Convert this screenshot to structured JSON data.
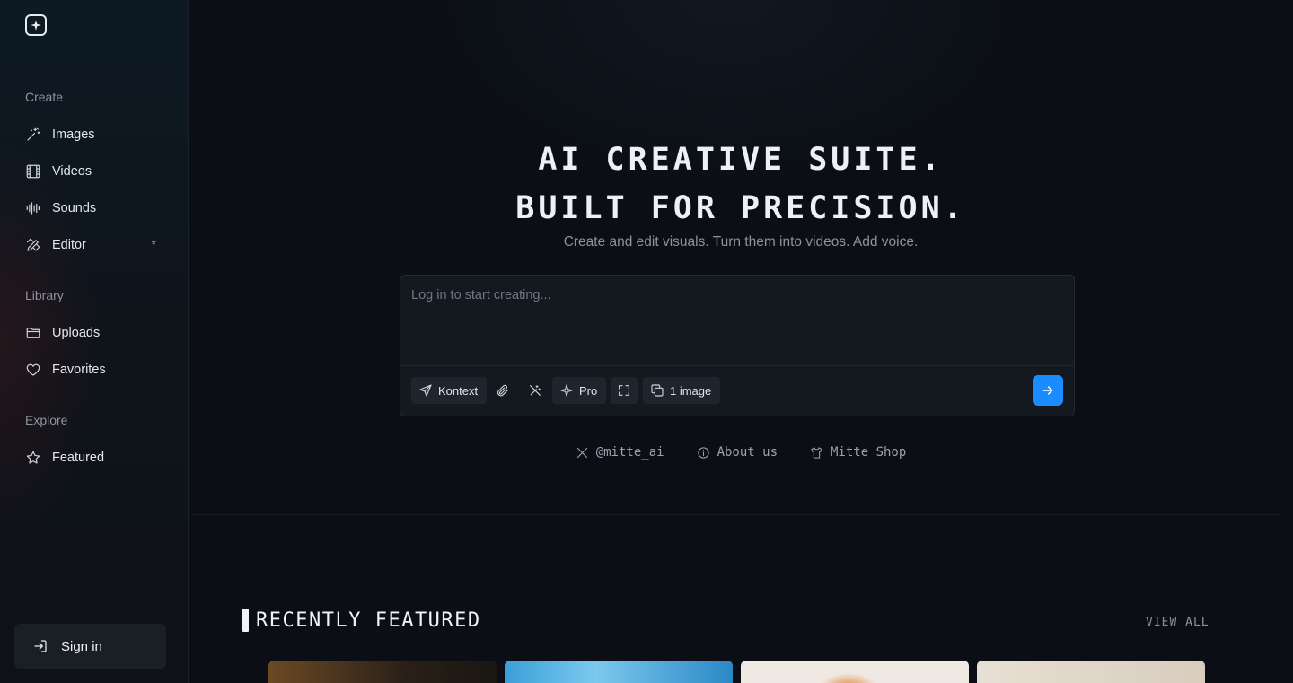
{
  "sidebar": {
    "sections": [
      {
        "label": "Create",
        "items": [
          {
            "label": "Images",
            "icon": "magic-wand-icon"
          },
          {
            "label": "Videos",
            "icon": "film-icon"
          },
          {
            "label": "Sounds",
            "icon": "waveform-icon"
          },
          {
            "label": "Editor",
            "icon": "pen-ruler-icon",
            "badge": "*"
          }
        ]
      },
      {
        "label": "Library",
        "items": [
          {
            "label": "Uploads",
            "icon": "folder-icon"
          },
          {
            "label": "Favorites",
            "icon": "heart-icon"
          }
        ]
      },
      {
        "label": "Explore",
        "items": [
          {
            "label": "Featured",
            "icon": "star-icon"
          }
        ]
      }
    ],
    "sign_in_label": "Sign in"
  },
  "hero": {
    "title_line1": "AI CREATIVE SUITE.",
    "title_line2": "BUILT FOR PRECISION.",
    "subtitle": "Create and edit visuals. Turn them into videos. Add voice."
  },
  "prompt": {
    "placeholder": "Log in to start creating...",
    "value": "",
    "model_label": "Kontext",
    "quality_label": "Pro",
    "count_label": "1 image"
  },
  "links": [
    {
      "label": "@mitte_ai",
      "icon": "x-logo-icon"
    },
    {
      "label": "About us",
      "icon": "info-icon"
    },
    {
      "label": "Mitte Shop",
      "icon": "shirt-icon"
    }
  ],
  "featured": {
    "title": "RECENTLY FEATURED",
    "view_all_label": "VIEW ALL"
  },
  "colors": {
    "accent": "#1a8cff",
    "badge": "#ff6a2a",
    "background": "#0b0f15"
  }
}
